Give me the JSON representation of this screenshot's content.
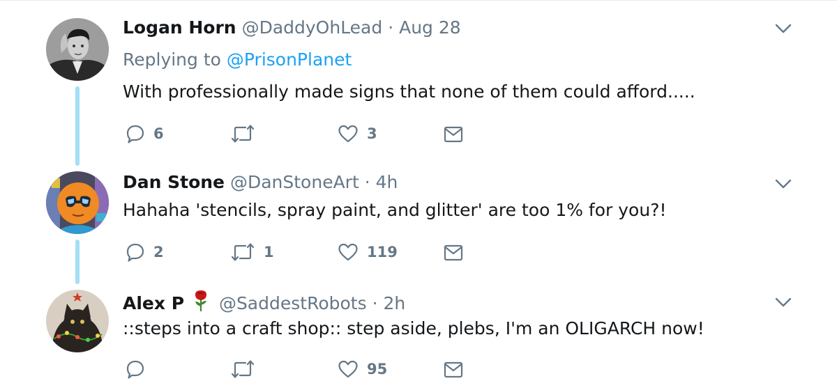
{
  "tweets": [
    {
      "name": "Logan Horn",
      "handle": "@DaddyOhLead",
      "separator": "·",
      "time": "Aug 28",
      "replying_prefix": "Replying to",
      "replying_to": "@PrisonPlanet",
      "text": "With professionally made signs that none of them could afford.....",
      "replies": "6",
      "retweets": "",
      "likes": "3",
      "avatar_icon": "vintage-man-portrait"
    },
    {
      "name": "Dan Stone",
      "handle": "@DanStoneArt",
      "separator": "·",
      "time": "4h",
      "text": "Hahaha 'stencils, spray paint, and glitter' are too 1% for you?!",
      "replies": "2",
      "retweets": "1",
      "likes": "119",
      "avatar_icon": "cartoon-orange-character-with-sunglasses"
    },
    {
      "name": "Alex P",
      "name_emoji": "rose-icon",
      "handle": "@SaddestRobots",
      "separator": "·",
      "time": "2h",
      "text": "::steps into a craft shop:: step aside, plebs, I'm an OLIGARCH now!",
      "replies": "",
      "retweets": "",
      "likes": "95",
      "avatar_icon": "cat-with-christmas-lights"
    }
  ],
  "colors": {
    "accent": "#1da1f2",
    "muted": "#657786",
    "thread_line": "#a3dff8",
    "text": "#14171a"
  },
  "icons": [
    "reply-icon",
    "retweet-icon",
    "like-icon",
    "dm-icon",
    "chevron-down-icon"
  ]
}
